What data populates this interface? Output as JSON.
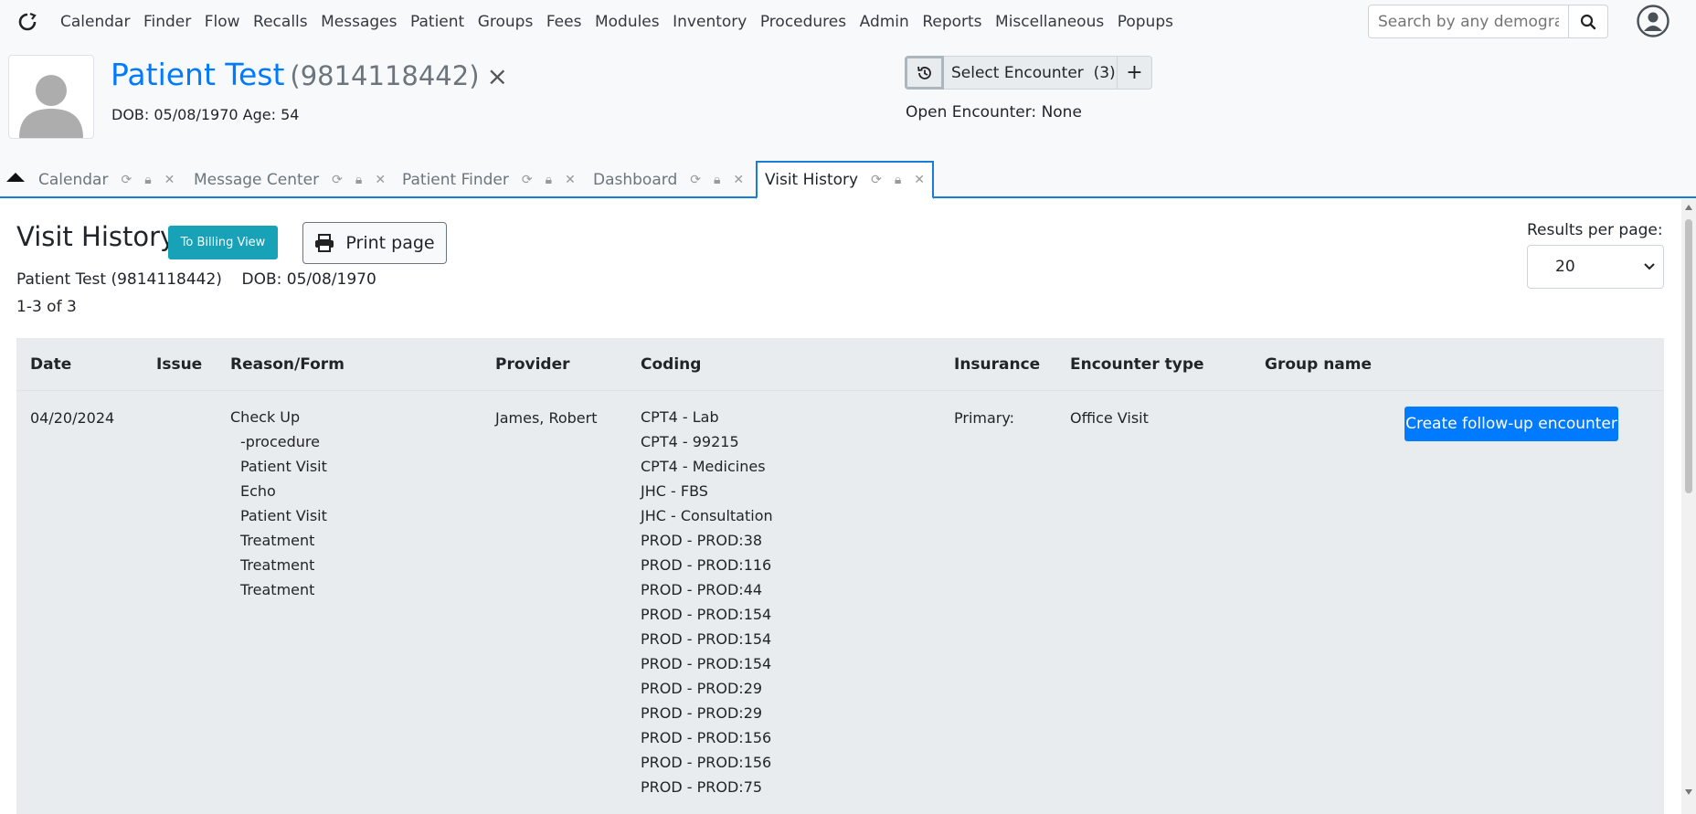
{
  "nav": {
    "items": [
      "Calendar",
      "Finder",
      "Flow",
      "Recalls",
      "Messages",
      "Patient",
      "Groups",
      "Fees",
      "Modules",
      "Inventory",
      "Procedures",
      "Admin",
      "Reports",
      "Miscellaneous",
      "Popups"
    ],
    "search_placeholder": "Search by any demographics"
  },
  "patient": {
    "name": "Patient Test",
    "id": "(9814118442)",
    "close": "×",
    "dob_age": "DOB: 05/08/1970 Age: 54"
  },
  "encounter": {
    "select_label": "Select Encounter",
    "count": "(3)",
    "add": "+",
    "open_text": "Open Encounter: None"
  },
  "tabs": [
    {
      "label": "Calendar"
    },
    {
      "label": "Message Center"
    },
    {
      "label": "Patient Finder"
    },
    {
      "label": "Dashboard"
    },
    {
      "label": "Visit History"
    }
  ],
  "page": {
    "title": "Visit History",
    "billing_btn": "To Billing View",
    "print_btn": "Print page",
    "patient_line": "Patient Test (9814118442)",
    "dob_line": "DOB: 05/08/1970",
    "count": "1-3 of 3",
    "rpp_label": "Results per page:",
    "rpp_value": "20"
  },
  "table": {
    "headers": [
      "Date",
      "Issue",
      "Reason/Form",
      "Provider",
      "Coding",
      "Insurance",
      "Encounter type",
      "Group name"
    ],
    "row": {
      "date": "04/20/2024",
      "reason": [
        "Check Up",
        "-procedure",
        "Patient Visit",
        "Echo",
        "Patient Visit",
        "Treatment",
        "Treatment",
        "Treatment"
      ],
      "provider": "James, Robert",
      "coding": [
        "CPT4 - Lab",
        "CPT4 - 99215",
        "CPT4 - Medicines",
        "JHC - FBS",
        "JHC - Consultation",
        "PROD - PROD:38",
        "PROD - PROD:116",
        "PROD - PROD:44",
        "PROD - PROD:154",
        "PROD - PROD:154",
        "PROD - PROD:154",
        "PROD - PROD:29",
        "PROD - PROD:29",
        "PROD - PROD:156",
        "PROD - PROD:156",
        "PROD - PROD:75"
      ],
      "insurance": "Primary:",
      "encounter_type": "Office Visit",
      "followup_btn": "Create follow-up encounter"
    }
  },
  "colors": {
    "primary": "#007bff",
    "info": "#17a2b8",
    "tab_border": "#1a7bd8"
  }
}
